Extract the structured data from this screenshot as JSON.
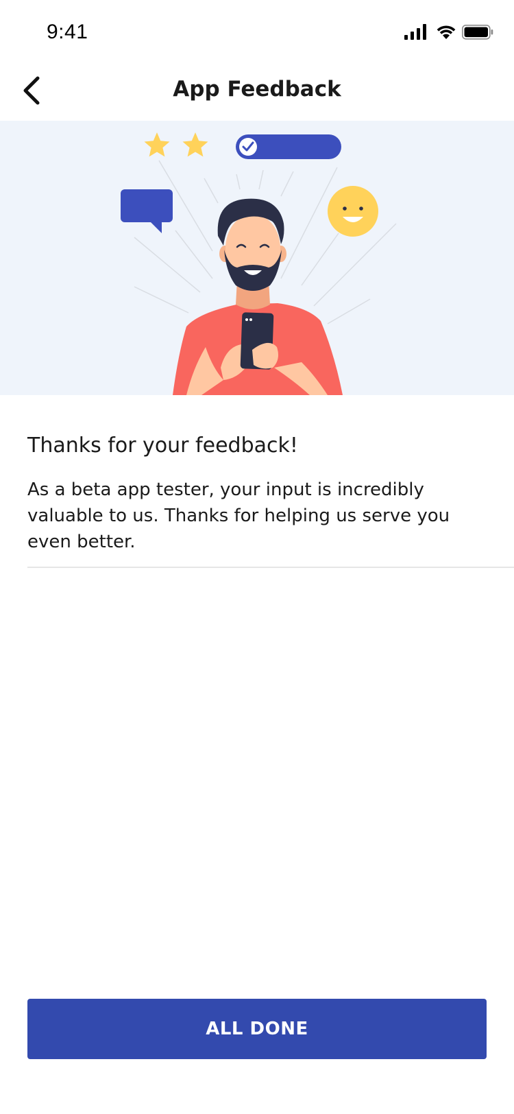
{
  "status_bar": {
    "time": "9:41",
    "icons": [
      "signal-icon",
      "wifi-icon",
      "battery-icon"
    ]
  },
  "nav": {
    "title": "App Feedback",
    "back_icon": "chevron-left-icon"
  },
  "content": {
    "headline": "Thanks for your feedback!",
    "body": "As a beta app tester, your input is incredibly valuable to us. Thanks for helping us serve you even better."
  },
  "actions": {
    "done_label": "ALL DONE"
  },
  "colors": {
    "primary": "#334aae",
    "hero_background": "#eff4fb",
    "star": "#ffd25a",
    "shirt": "#f9665e"
  }
}
